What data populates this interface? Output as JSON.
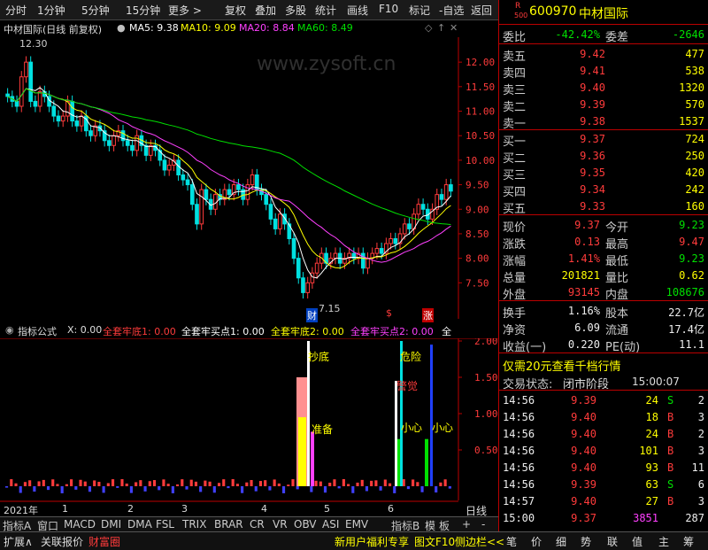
{
  "toolbar": {
    "periods": [
      "分时",
      "1分钟",
      "5分钟",
      "15分钟"
    ],
    "more": "更多 >",
    "actions": [
      "复权",
      "叠加",
      "多股",
      "统计",
      "画线",
      "F10",
      "标记",
      "-自选",
      "返回"
    ]
  },
  "chart_header": {
    "title": "中材国际(日线 前复权)",
    "ma5": "MA5: 9.38",
    "ma10": "MA10: 9.09",
    "ma20": "MA20: 8.84",
    "ma60": "MA60: 8.49",
    "watermark": "www.zysoft.cn"
  },
  "colors": {
    "ma5": "#ffffff",
    "ma10": "#ffff00",
    "ma20": "#ff40ff",
    "ma60": "#00e000",
    "up": "#ff3b3b",
    "down": "#00e0e0"
  },
  "chart_data": [
    {
      "type": "candlestick",
      "title": "中材国际(日线 前复权)",
      "ylim": [
        7.0,
        12.4
      ],
      "yticks": [
        "12.00",
        "11.50",
        "11.00",
        "10.50",
        "10.00",
        "9.50",
        "9.00",
        "8.50",
        "8.00",
        "7.50"
      ],
      "xticks": [
        "2021年",
        "1",
        "2",
        "3",
        "4",
        "5",
        "6"
      ],
      "annotations": {
        "high": "12.30",
        "low": "7.15",
        "badge_cai": "财",
        "badge_jin": "$",
        "badge_zhang": "涨"
      },
      "close": [
        11.3,
        11.2,
        11.1,
        11.7,
        12.0,
        11.2,
        11.1,
        11.4,
        11.3,
        11.1,
        10.9,
        10.8,
        10.9,
        11.2,
        10.8,
        10.7,
        10.9,
        10.6,
        10.5,
        10.7,
        10.6,
        10.4,
        10.3,
        10.5,
        10.6,
        10.4,
        10.3,
        10.2,
        10.5,
        10.3,
        10.1,
        10.3,
        10.2,
        10.0,
        9.8,
        9.9,
        10.0,
        9.7,
        9.6,
        9.5,
        9.1,
        8.7,
        9.4,
        9.2,
        9.0,
        9.3,
        9.2,
        9.4,
        9.3,
        9.5,
        9.4,
        9.2,
        9.5,
        9.7,
        9.4,
        9.3,
        9.1,
        8.8,
        8.6,
        8.9,
        8.7,
        8.4,
        8.0,
        7.6,
        7.3,
        7.5,
        7.7,
        7.9,
        8.1,
        7.9,
        8.0,
        8.1,
        7.9,
        8.0,
        8.1,
        8.0,
        8.1,
        7.8,
        8.0,
        8.1,
        8.2,
        8.1,
        8.3,
        8.4,
        8.3,
        8.5,
        8.7,
        8.6,
        8.9,
        9.1,
        9.0,
        8.8,
        9.0,
        9.3,
        9.2,
        9.5,
        9.37
      ]
    },
    {
      "type": "bar",
      "title": "指标公式",
      "series": [
        {
          "name": "全套牢底1",
          "value": "0.00"
        },
        {
          "name": "全套牢买点1",
          "value": "0.00"
        },
        {
          "name": "全套牢底2",
          "value": "0.00"
        },
        {
          "name": "全套牢买点2",
          "value": "0.00"
        }
      ],
      "yticks": [
        "2.00",
        "1.50",
        "1.00",
        "0.50"
      ],
      "labels": {
        "chaodi": "抄底",
        "zhunbei": "准备",
        "weixian": "危险",
        "jingjue": "警觉",
        "xiaoxin1": "小心",
        "xiaoxin2": "小心"
      }
    }
  ],
  "indicator_header": {
    "name": "指标公式",
    "x": "X: 0.00",
    "l1": "全套牢底1: 0.00",
    "l2": "全套牢买点1: 0.00",
    "l3": "全套牢底2: 0.00",
    "l4": "全套牢买点2: 0.00",
    "l5": "全"
  },
  "date_label": "日线",
  "tabs": [
    "指标A",
    "窗口",
    "MACD",
    "DMI",
    "DMA",
    "FSL",
    "TRIX",
    "BRAR",
    "CR",
    "VR",
    "OBV",
    "ASI",
    "EMV",
    "指标B",
    "模",
    "板",
    "+",
    "-"
  ],
  "bottom_bar": {
    "left": [
      "扩展∧",
      "关联报价",
      "财富圈"
    ],
    "right": [
      "新用户福利专享",
      "图文F10",
      "侧边栏<<"
    ],
    "tabs": [
      "笔",
      "价",
      "细",
      "势",
      "联",
      "值",
      "主",
      "筹"
    ]
  },
  "quote": {
    "code": "600970",
    "name": "中材国际",
    "r_badge": "R",
    "r_sub": "500",
    "weibi_label": "委比",
    "weibi": "-42.42%",
    "weicha_label": "委差",
    "weicha": "-2646",
    "asks": [
      {
        "label": "卖五",
        "price": "9.42",
        "vol": "477"
      },
      {
        "label": "卖四",
        "price": "9.41",
        "vol": "538"
      },
      {
        "label": "卖三",
        "price": "9.40",
        "vol": "1320"
      },
      {
        "label": "卖二",
        "price": "9.39",
        "vol": "570"
      },
      {
        "label": "卖一",
        "price": "9.38",
        "vol": "1537"
      }
    ],
    "bids": [
      {
        "label": "买一",
        "price": "9.37",
        "vol": "724"
      },
      {
        "label": "买二",
        "price": "9.36",
        "vol": "250"
      },
      {
        "label": "买三",
        "price": "9.35",
        "vol": "420"
      },
      {
        "label": "买四",
        "price": "9.34",
        "vol": "242"
      },
      {
        "label": "买五",
        "price": "9.33",
        "vol": "160"
      }
    ],
    "stats": [
      {
        "l1": "现价",
        "v1": "9.37",
        "c1": "red",
        "l2": "今开",
        "v2": "9.23",
        "c2": "green"
      },
      {
        "l1": "涨跌",
        "v1": "0.13",
        "c1": "red",
        "l2": "最高",
        "v2": "9.47",
        "c2": "red"
      },
      {
        "l1": "涨幅",
        "v1": "1.41%",
        "c1": "red",
        "l2": "最低",
        "v2": "9.23",
        "c2": "green"
      },
      {
        "l1": "总量",
        "v1": "201821",
        "c1": "yellow",
        "l2": "量比",
        "v2": "0.62",
        "c2": "yellow"
      },
      {
        "l1": "外盘",
        "v1": "93145",
        "c1": "red",
        "l2": "内盘",
        "v2": "108676",
        "c2": "green"
      }
    ],
    "fin": [
      {
        "l1": "换手",
        "v1": "1.16%",
        "l2": "股本",
        "v2": "22.7亿"
      },
      {
        "l1": "净资",
        "v1": "6.09",
        "l2": "流通",
        "v2": "17.4亿"
      },
      {
        "l1": "收益(一)",
        "v1": "0.220",
        "l2": "PE(动)",
        "v2": "11.1"
      }
    ],
    "promo": "仅需20元查看千档行情",
    "status_label": "交易状态:",
    "status": "闭市阶段",
    "status_time": "15:00:07",
    "ticks": [
      {
        "t": "14:56",
        "p": "9.39",
        "v": "24",
        "s": "S",
        "n": "2"
      },
      {
        "t": "14:56",
        "p": "9.40",
        "v": "18",
        "s": "B",
        "n": "3"
      },
      {
        "t": "14:56",
        "p": "9.40",
        "v": "24",
        "s": "B",
        "n": "2"
      },
      {
        "t": "14:56",
        "p": "9.40",
        "v": "101",
        "s": "B",
        "n": "3"
      },
      {
        "t": "14:56",
        "p": "9.40",
        "v": "93",
        "s": "B",
        "n": "11"
      },
      {
        "t": "14:56",
        "p": "9.39",
        "v": "63",
        "s": "S",
        "n": "6"
      },
      {
        "t": "14:57",
        "p": "9.40",
        "v": "27",
        "s": "B",
        "n": "3"
      },
      {
        "t": "15:00",
        "p": "9.37",
        "v": "3851",
        "s": "",
        "n": "287"
      }
    ]
  }
}
